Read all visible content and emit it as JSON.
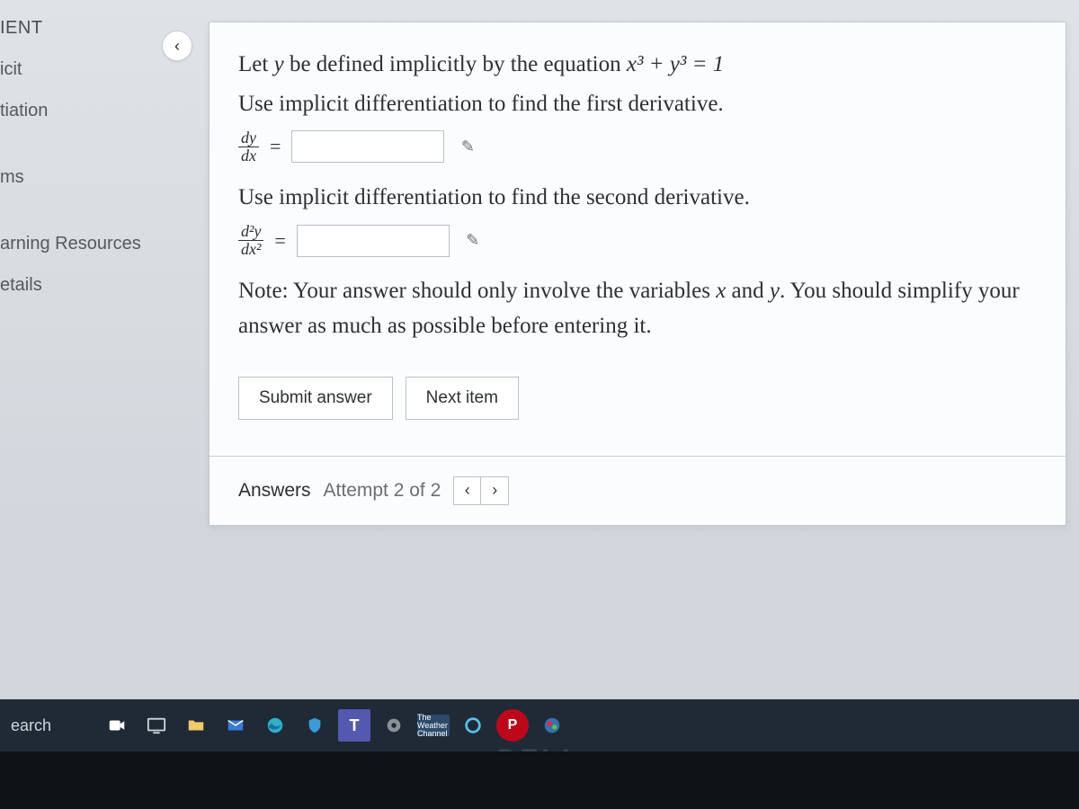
{
  "sidebar": {
    "header": "IENT",
    "items": [
      "icit",
      "tiation",
      "ms",
      "arning Resources",
      "etails"
    ]
  },
  "backButton": {
    "glyph": "‹"
  },
  "question": {
    "line1_a": "Let ",
    "line1_var": "y",
    "line1_b": " be defined implicitly by the equation ",
    "line1_eq": "x³ + y³ = 1",
    "line2": "Use implicit differentiation to find the first derivative.",
    "frac1": {
      "num": "dy",
      "den": "dx"
    },
    "equals": "=",
    "line3": "Use implicit differentiation to find the second derivative.",
    "frac2": {
      "num": "d²y",
      "den": "dx²"
    },
    "note_a": "Note: Your answer should only involve the variables ",
    "note_x": "x",
    "note_and": " and ",
    "note_y": "y",
    "note_b": ". You should simplify your answer as much as possible before entering it.",
    "wand_glyph": "✎"
  },
  "buttons": {
    "submit": "Submit answer",
    "next": "Next item"
  },
  "answers": {
    "label": "Answers",
    "attempt": "Attempt 2 of 2",
    "prev": "‹",
    "nextNav": "›"
  },
  "taskbar": {
    "search": "earch",
    "weather": "The\nWeather\nChannel"
  },
  "brand": "DELL"
}
